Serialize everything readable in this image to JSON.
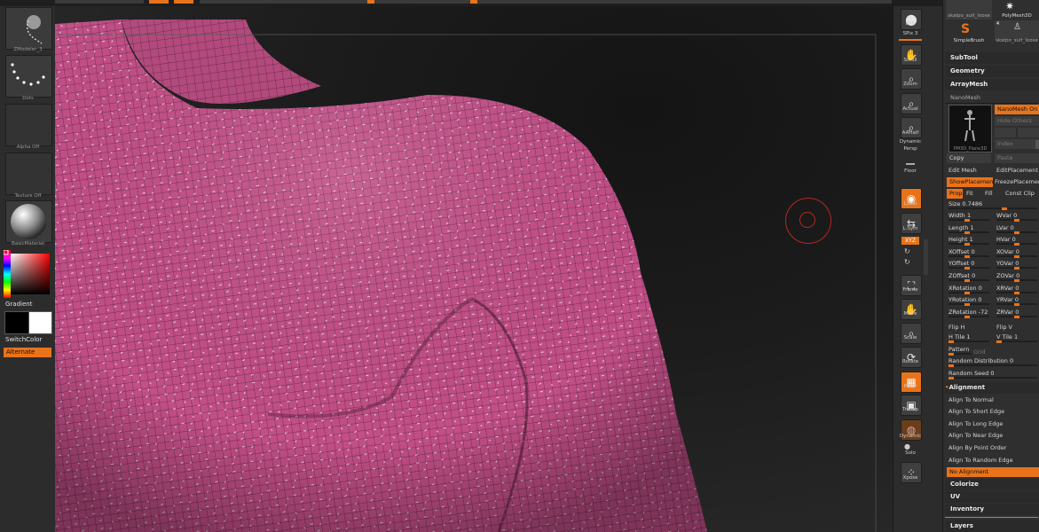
{
  "left_panel": {
    "brush_label": "ZModeler_3",
    "stroke_label": "Dots",
    "alpha_label": "Alpha Off",
    "texture_label": "Texture Off",
    "material_label": "BasicMaterial",
    "gradient_label": "Gradient",
    "switchcolor_label": "SwitchColor",
    "alternate_label": "Alternate"
  },
  "shelf": {
    "bpr": "BPR",
    "spix_label": "SPix",
    "spix_value": "3",
    "scroll": "Scroll",
    "zoom": "Zoom",
    "actual": "Actual",
    "aahalf": "AAHalf",
    "dynamic": "Dynamic",
    "persp": "Persp",
    "floor": "Floor",
    "local": "Local",
    "lsym": "L.Sym",
    "xyz": "XYZ",
    "frame": "Frame",
    "move": "Move",
    "scale": "Scale",
    "rotate": "Rotate",
    "polyf": "PolyF",
    "transp": "Transp",
    "dynamic2": "Dynamic",
    "solo": "Solo",
    "xpose": "Xpose"
  },
  "palette": {
    "tools": [
      {
        "label": "skalpo_suit_loose",
        "num": ""
      },
      {
        "label": "PolyMesh3D",
        "num": ""
      },
      {
        "label": "SimpleBrush",
        "num": ""
      },
      {
        "label": "skalpo_suit_loose",
        "num": "4"
      }
    ],
    "subtool": "SubTool",
    "geometry": "Geometry",
    "arraymesh": "ArrayMesh",
    "nanomesh": "NanoMesh",
    "nanomesh_on": "NanoMesh On",
    "hide_others": "Hide Others",
    "index": "Index",
    "thumb_name": "PM3D_Plane3D",
    "copy": "Copy",
    "paste": "Paste",
    "edit_mesh": "Edit Mesh",
    "edit_placement": "EditPlacement",
    "show_placement": "ShowPlacement",
    "freeze_placement": "FreezePlacement",
    "prop": "Prop",
    "fit": "Fit",
    "fill": "Fill",
    "const_clip": "Const Clip",
    "size_label": "Size",
    "size_value": "0.7486",
    "sliders_left": [
      {
        "label": "Width",
        "value": "1"
      },
      {
        "label": "Length",
        "value": "1"
      },
      {
        "label": "Height",
        "value": "1"
      },
      {
        "label": "XOffset",
        "value": "0"
      },
      {
        "label": "YOffset",
        "value": "0"
      },
      {
        "label": "ZOffset",
        "value": "0"
      },
      {
        "label": "XRotation",
        "value": "0"
      },
      {
        "label": "YRotation",
        "value": "0"
      },
      {
        "label": "ZRotation",
        "value": "-72"
      }
    ],
    "sliders_right": [
      {
        "label": "WVar",
        "value": "0"
      },
      {
        "label": "LVar",
        "value": "0"
      },
      {
        "label": "HVar",
        "value": "0"
      },
      {
        "label": "XOVar",
        "value": "0"
      },
      {
        "label": "YOVar",
        "value": "0"
      },
      {
        "label": "ZOVar",
        "value": "0"
      },
      {
        "label": "XRVar",
        "value": "0"
      },
      {
        "label": "YRVar",
        "value": "0"
      },
      {
        "label": "ZRVar",
        "value": "0"
      }
    ],
    "flip_h": "Flip H",
    "flip_v": "Flip V",
    "h_tile_label": "H Tile",
    "h_tile_value": "1",
    "v_tile_label": "V Tile",
    "v_tile_value": "1",
    "pattern": "Pattern",
    "grid": "Grid",
    "random_distribution_label": "Random Distribution",
    "random_distribution_value": "0",
    "random_seed_label": "Random Seed",
    "random_seed_value": "0",
    "alignment": "Alignment",
    "align_items": [
      "Align To Normal",
      "Align To Short Edge",
      "Align To Long Edge",
      "Align To Near Edge",
      "Align By Point Order",
      "Align To Random Edge"
    ],
    "no_alignment": "No Alignment",
    "colorize": "Colorize",
    "uv": "UV",
    "inventory": "Inventory",
    "layers": "Layers"
  },
  "colors": {
    "accent": "#e8731a",
    "mesh": "#c24f87",
    "brush_cursor": "#b5271f"
  }
}
